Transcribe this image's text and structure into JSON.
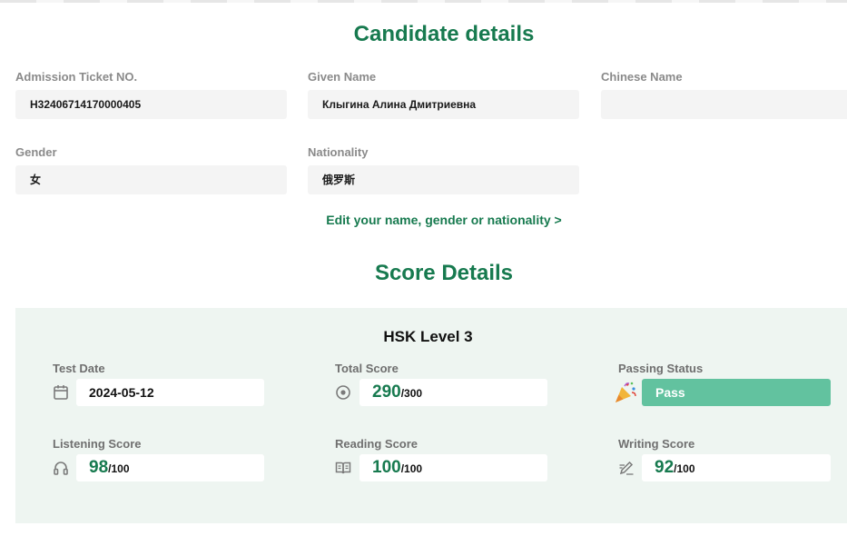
{
  "candidate": {
    "title": "Candidate details",
    "fields": {
      "admission": {
        "label": "Admission Ticket NO.",
        "value": "H32406714170000405"
      },
      "given_name": {
        "label": "Given Name",
        "value": "Клыгина Алина Дмитриевна"
      },
      "chinese_name": {
        "label": "Chinese Name",
        "value": ""
      },
      "gender": {
        "label": "Gender",
        "value": "女"
      },
      "nationality": {
        "label": "Nationality",
        "value": "俄罗斯"
      }
    },
    "edit_link": "Edit your name, gender or nationality >"
  },
  "score": {
    "title": "Score Details",
    "level": "HSK Level 3",
    "test_date": {
      "label": "Test Date",
      "value": "2024-05-12",
      "icon": "calendar-icon"
    },
    "total": {
      "label": "Total Score",
      "value": "290",
      "max": "/300",
      "icon": "target-icon"
    },
    "passing": {
      "label": "Passing Status",
      "value": "Pass",
      "icon": "party-popper-icon",
      "color": "#62c29f"
    },
    "listening": {
      "label": "Listening Score",
      "value": "98",
      "max": "/100",
      "icon": "headphones-icon"
    },
    "reading": {
      "label": "Reading Score",
      "value": "100",
      "max": "/100",
      "icon": "book-icon"
    },
    "writing": {
      "label": "Writing Score",
      "value": "92",
      "max": "/100",
      "icon": "pencil-icon"
    }
  },
  "colors": {
    "accent": "#177a4f",
    "panel": "#eef5f1",
    "field_bg": "#f4f4f4"
  }
}
